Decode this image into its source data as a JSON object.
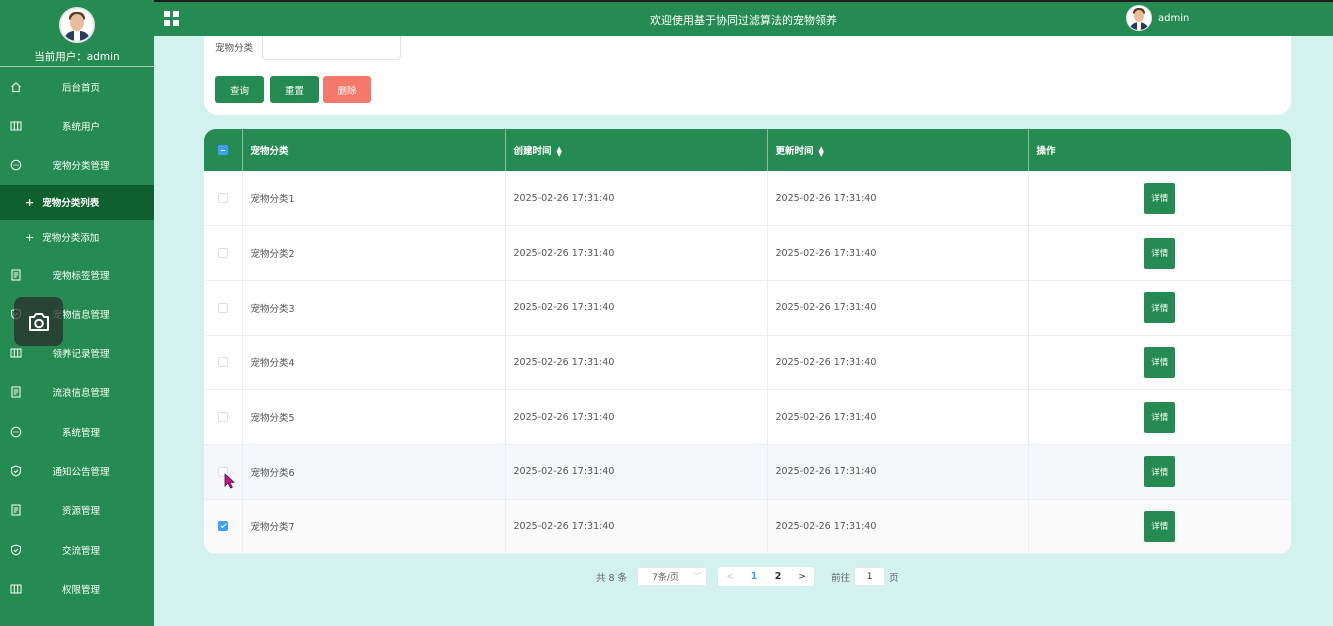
{
  "sidebar": {
    "current_user_label": "当前用户：",
    "current_user_name": "admin",
    "items": [
      {
        "label": "后台首页",
        "icon": "home-icon"
      },
      {
        "label": "系统用户",
        "icon": "columns-icon"
      },
      {
        "label": "宠物分类管理",
        "icon": "chat-icon"
      }
    ],
    "sub_items": [
      {
        "label": "宠物分类列表",
        "active": true
      },
      {
        "label": "宠物分类添加",
        "active": false
      }
    ],
    "items_after": [
      {
        "label": "宠物标签管理",
        "icon": "document-icon"
      },
      {
        "label": "宠物信息管理",
        "icon": "shield-icon"
      },
      {
        "label": "领养记录管理",
        "icon": "columns-icon"
      },
      {
        "label": "流浪信息管理",
        "icon": "document-icon"
      },
      {
        "label": "系统管理",
        "icon": "chat-icon"
      },
      {
        "label": "通知公告管理",
        "icon": "shield-icon"
      },
      {
        "label": "资源管理",
        "icon": "document-icon"
      },
      {
        "label": "交流管理",
        "icon": "shield-icon"
      },
      {
        "label": "权限管理",
        "icon": "columns-icon"
      }
    ]
  },
  "header": {
    "title": "欢迎使用基于协同过滤算法的宠物领养",
    "user_name": "admin"
  },
  "search": {
    "label": "宠物分类",
    "value": "",
    "query_label": "查询",
    "reset_label": "重置",
    "delete_label": "删除"
  },
  "table": {
    "columns": [
      "宠物分类",
      "创建时间",
      "更新时间",
      "操作"
    ],
    "detail_label": "详情",
    "rows": [
      {
        "name": "宠物分类1",
        "created": "2025-02-26 17:31:40",
        "updated": "2025-02-26 17:31:40",
        "checked": false
      },
      {
        "name": "宠物分类2",
        "created": "2025-02-26 17:31:40",
        "updated": "2025-02-26 17:31:40",
        "checked": false
      },
      {
        "name": "宠物分类3",
        "created": "2025-02-26 17:31:40",
        "updated": "2025-02-26 17:31:40",
        "checked": false
      },
      {
        "name": "宠物分类4",
        "created": "2025-02-26 17:31:40",
        "updated": "2025-02-26 17:31:40",
        "checked": false
      },
      {
        "name": "宠物分类5",
        "created": "2025-02-26 17:31:40",
        "updated": "2025-02-26 17:31:40",
        "checked": false
      },
      {
        "name": "宠物分类6",
        "created": "2025-02-26 17:31:40",
        "updated": "2025-02-26 17:31:40",
        "checked": false
      },
      {
        "name": "宠物分类7",
        "created": "2025-02-26 17:31:40",
        "updated": "2025-02-26 17:31:40",
        "checked": true
      }
    ]
  },
  "pagination": {
    "total": "共 8 条",
    "page_size": "7条/页",
    "pages": [
      "1",
      "2"
    ],
    "current": "1",
    "goto_label": "前往",
    "goto_value": "1",
    "page_unit": "页"
  },
  "colors": {
    "primary": "#258b53",
    "sidebar_active": "#0f5f2f",
    "danger": "#f5786d",
    "background": "#d3f2ee",
    "checkbox": "#409eff"
  }
}
